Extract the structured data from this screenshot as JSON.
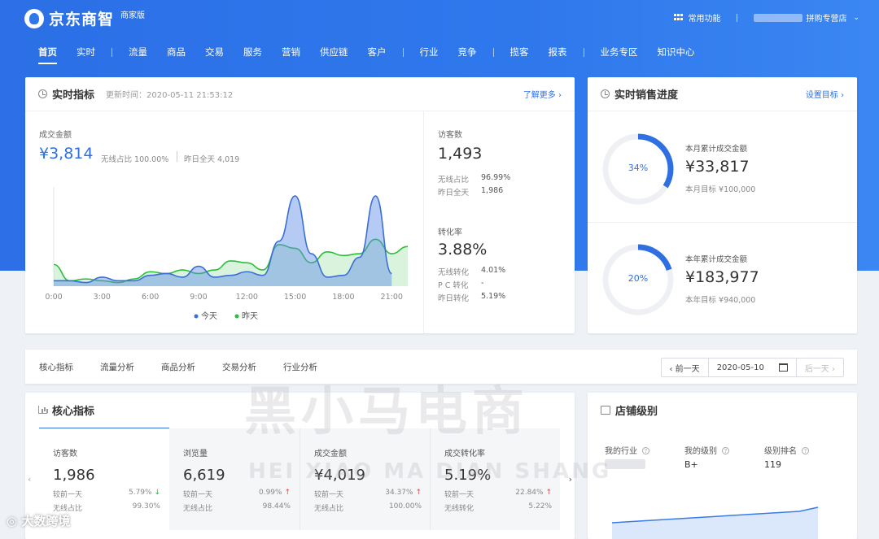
{
  "topbar": {
    "logo_text": "京东商智",
    "logo_sub": "商家版",
    "common_functions": "常用功能",
    "shop_name": "拼购专营店"
  },
  "nav": {
    "items": [
      "首页",
      "实时",
      "流量",
      "商品",
      "交易",
      "服务",
      "营销",
      "供应链",
      "客户",
      "行业",
      "竞争",
      "揽客",
      "报表",
      "业务专区",
      "知识中心"
    ],
    "active": "首页"
  },
  "realtime": {
    "title": "实时指标",
    "updated": "更新时间：2020-05-11 21:53:12",
    "more_link": "了解更多 ›",
    "gmv_label": "成交金额",
    "gmv_value": "¥3,814",
    "wireless_share": "无线占比 100.00%",
    "yesterday_total": "昨日全天 4,019",
    "visitors_label": "访客数",
    "visitors_value": "1,493",
    "visitors_wireless_label": "无线占比",
    "visitors_wireless_value": "96.99%",
    "visitors_yesterday_label": "昨日全天",
    "visitors_yesterday_value": "1,986",
    "conv_label": "转化率",
    "conv_value": "3.88%",
    "conv_wireless_label": "无线转化",
    "conv_wireless_value": "4.01%",
    "conv_pc_label": "P C 转化",
    "conv_pc_value": "-",
    "conv_yesterday_label": "昨日转化",
    "conv_yesterday_value": "5.19%"
  },
  "chart_data": {
    "type": "area",
    "x": [
      "0:00",
      "1:00",
      "2:00",
      "3:00",
      "4:00",
      "5:00",
      "6:00",
      "7:00",
      "8:00",
      "9:00",
      "10:00",
      "11:00",
      "12:00",
      "13:00",
      "14:00",
      "15:00",
      "16:00",
      "17:00",
      "18:00",
      "19:00",
      "20:00",
      "21:00",
      "22:00"
    ],
    "x_tick_labels": [
      "0:00",
      "3:00",
      "6:00",
      "9:00",
      "12:00",
      "15:00",
      "18:00",
      "21:00"
    ],
    "series": [
      {
        "name": "今天",
        "color": "#3b6fd6",
        "values": [
          3,
          3,
          2,
          5,
          3,
          3,
          6,
          7,
          5,
          11,
          5,
          6,
          8,
          6,
          25,
          50,
          18,
          5,
          6,
          16,
          50,
          7,
          null
        ]
      },
      {
        "name": "昨天",
        "color": "#2bbf3a",
        "values": [
          12,
          3,
          4,
          3,
          2,
          4,
          8,
          7,
          9,
          7,
          9,
          14,
          13,
          9,
          23,
          21,
          13,
          19,
          17,
          18,
          26,
          18,
          22
        ]
      }
    ],
    "legend_position": "bottom",
    "grid": false
  },
  "sales_progress": {
    "title": "实时销售进度",
    "set_target_link": "设置目标 ›",
    "month": {
      "pct_text": "34%",
      "pct": 0.34,
      "label": "本月累计成交金额",
      "value": "¥33,817",
      "target": "本月目标 ¥100,000"
    },
    "year": {
      "pct_text": "20%",
      "pct": 0.2,
      "label": "本年累计成交金额",
      "value": "¥183,977",
      "target": "本年目标 ¥940,000"
    },
    "ring_color": "#2f6fe2"
  },
  "analysis_tabs": [
    "核心指标",
    "流量分析",
    "商品分析",
    "交易分析",
    "行业分析"
  ],
  "date_nav": {
    "prev": "‹ 前一天",
    "date": "2020-05-10",
    "next": "后一天 ›"
  },
  "core": {
    "title": "核心指标",
    "metrics": [
      {
        "name": "访客数",
        "value": "1,986",
        "cmp_label": "较前一天",
        "cmp_value": "5.79%",
        "cmp_dir": "↓",
        "sub_label": "无线占比",
        "sub_value": "99.30%"
      },
      {
        "name": "浏览量",
        "value": "6,619",
        "cmp_label": "较前一天",
        "cmp_value": "0.99%",
        "cmp_dir": "↑",
        "sub_label": "无线占比",
        "sub_value": "98.44%"
      },
      {
        "name": "成交金额",
        "value": "¥4,019",
        "cmp_label": "较前一天",
        "cmp_value": "34.37%",
        "cmp_dir": "↑",
        "sub_label": "无线占比",
        "sub_value": "100.00%"
      },
      {
        "name": "成交转化率",
        "value": "5.19%",
        "cmp_label": "较前一天",
        "cmp_value": "22.84%",
        "cmp_dir": "↑",
        "sub_label": "无线转化",
        "sub_value": "5.22%"
      }
    ]
  },
  "shop_level": {
    "title": "店铺级别",
    "industry_label": "我的行业",
    "level_label": "我的级别",
    "level_value": "B+",
    "rank_label": "级别排名",
    "rank_value": "119"
  },
  "watermark": {
    "cn": "黑小马电商",
    "en": "HEI XIAO MA DIAN SHANG",
    "corner": "大数跨境"
  }
}
